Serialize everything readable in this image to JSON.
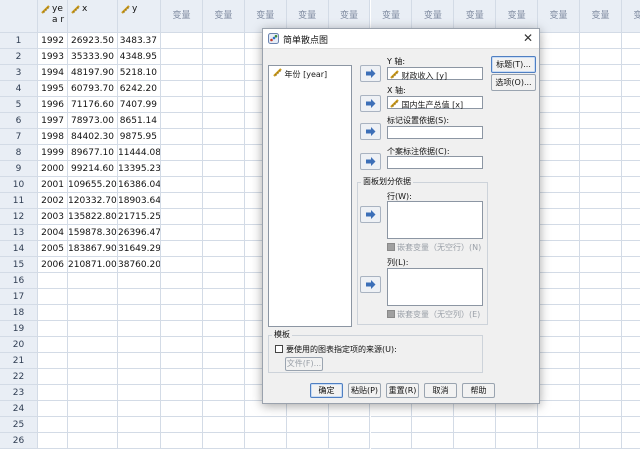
{
  "grid": {
    "columns": [
      {
        "name": "year",
        "kind": "var",
        "display": "yea r"
      },
      {
        "name": "x",
        "kind": "var"
      },
      {
        "name": "y",
        "kind": "var"
      },
      {
        "name": "变量",
        "kind": "empty"
      },
      {
        "name": "变量",
        "kind": "empty"
      },
      {
        "name": "变量",
        "kind": "empty"
      },
      {
        "name": "变量",
        "kind": "empty"
      },
      {
        "name": "变量",
        "kind": "empty"
      },
      {
        "name": "变量",
        "kind": "empty"
      },
      {
        "name": "变量",
        "kind": "empty"
      },
      {
        "name": "变量",
        "kind": "empty"
      },
      {
        "name": "变量",
        "kind": "empty"
      },
      {
        "name": "变量",
        "kind": "empty"
      },
      {
        "name": "变量",
        "kind": "empty"
      },
      {
        "name": "变量",
        "kind": "empty"
      }
    ],
    "rows": [
      [
        "1",
        "1992",
        "26923.50",
        "3483.37"
      ],
      [
        "2",
        "1993",
        "35333.90",
        "4348.95"
      ],
      [
        "3",
        "1994",
        "48197.90",
        "5218.10"
      ],
      [
        "4",
        "1995",
        "60793.70",
        "6242.20"
      ],
      [
        "5",
        "1996",
        "71176.60",
        "7407.99"
      ],
      [
        "6",
        "1997",
        "78973.00",
        "8651.14"
      ],
      [
        "7",
        "1998",
        "84402.30",
        "9875.95"
      ],
      [
        "8",
        "1999",
        "89677.10",
        "11444.08"
      ],
      [
        "9",
        "2000",
        "99214.60",
        "13395.23"
      ],
      [
        "10",
        "2001",
        "109655.20",
        "16386.04"
      ],
      [
        "11",
        "2002",
        "120332.70",
        "18903.64"
      ],
      [
        "12",
        "2003",
        "135822.80",
        "21715.25"
      ],
      [
        "13",
        "2004",
        "159878.30",
        "26396.47"
      ],
      [
        "14",
        "2005",
        "183867.90",
        "31649.29"
      ],
      [
        "15",
        "2006",
        "210871.00",
        "38760.20"
      ],
      [
        "16",
        "",
        "",
        ""
      ],
      [
        "17",
        "",
        "",
        ""
      ],
      [
        "18",
        "",
        "",
        ""
      ],
      [
        "19",
        "",
        "",
        ""
      ],
      [
        "20",
        "",
        "",
        ""
      ],
      [
        "21",
        "",
        "",
        ""
      ],
      [
        "22",
        "",
        "",
        ""
      ],
      [
        "23",
        "",
        "",
        ""
      ],
      [
        "24",
        "",
        "",
        ""
      ],
      [
        "25",
        "",
        "",
        ""
      ],
      [
        "26",
        "",
        "",
        ""
      ]
    ]
  },
  "dialog": {
    "title": "简单散点图",
    "close_glyph": "✕",
    "source_list": [
      "年份 [year]"
    ],
    "y_axis_label": "Y 轴:",
    "y_axis_value": "财政收入 [y]",
    "x_axis_label": "X 轴:",
    "x_axis_value": "国内生产总值 [x]",
    "marker_label": "标记设置依据(S):",
    "case_label": "个案标注依据(C):",
    "panel_group_label": "面板划分依据",
    "rows_label": "行(W):",
    "nest_rows_label": "嵌套变量（无空行）(N)",
    "cols_label": "列(L):",
    "nest_cols_label": "嵌套变量（无空列）(E)",
    "title_button": "标题(T)...",
    "options_button": "选项(O)...",
    "template_group_label": "模板",
    "template_checkbox_label": "要使用的图表指定项的来源(U):",
    "file_button": "文件(F)...",
    "ok_button": "确定",
    "paste_button": "粘贴(P)",
    "reset_button": "重置(R)",
    "cancel_button": "取消",
    "help_button": "帮助"
  },
  "colors": {
    "accent": "#4f7fc2",
    "header_bg": "#e9eef5",
    "grid_line": "#d3dbe6"
  }
}
